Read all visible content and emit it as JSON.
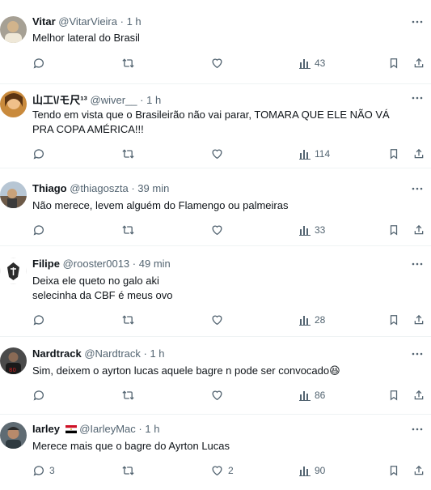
{
  "tweets": [
    {
      "name": "Vitar",
      "handle": "@VitarVieira",
      "time": "1 h",
      "lines": [
        "Melhor lateral do Brasil"
      ],
      "replies": "",
      "likes": "",
      "views": "43"
    },
    {
      "name": "山工\\/モ尺¹³",
      "handle": "@wiver__",
      "time": "1 h",
      "lines": [
        "Tendo em vista que o Brasileirão não vai parar, TOMARA QUE ELE NÃO VÁ",
        "PRA COPA AMÉRICA!!!"
      ],
      "replies": "",
      "likes": "",
      "views": "114"
    },
    {
      "name": "Thiago",
      "handle": "@thiagoszta",
      "time": "39 min",
      "lines": [
        "Não merece, levem alguém do Flamengo ou palmeiras"
      ],
      "replies": "",
      "likes": "",
      "views": "33"
    },
    {
      "name": "Filipe",
      "handle": "@rooster0013",
      "time": "49 min",
      "lines": [
        "Deixa ele queto no galo aki",
        "selecinha da CBF é meus ovo"
      ],
      "replies": "",
      "likes": "",
      "views": "28"
    },
    {
      "name": "Nardtrack",
      "handle": "@Nardtrack",
      "time": "1 h",
      "lines": [
        "Sim, deixem o ayrton lucas aquele bagre n pode ser convocado😆"
      ],
      "replies": "",
      "likes": "",
      "views": "86"
    },
    {
      "name": "Iarley",
      "handle": "@IarleyMac",
      "time": "1 h",
      "lines": [
        "Merece mais que o bagre do Ayrton Lucas"
      ],
      "replies": "3",
      "likes": "2",
      "views": "90"
    }
  ],
  "icons": {
    "reply": "reply-icon",
    "retweet": "retweet-icon",
    "like": "heart-icon",
    "views": "views-icon",
    "bookmark": "bookmark-icon",
    "share": "share-icon",
    "more": "more-icon"
  },
  "colors": {
    "text": "#0f1419",
    "secondary": "#536471",
    "divider": "#eff3f4"
  }
}
